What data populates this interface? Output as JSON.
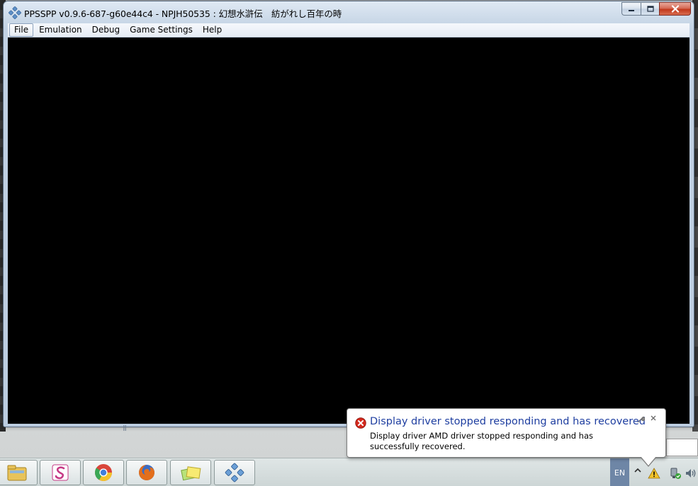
{
  "window": {
    "title": "PPSSPP v0.9.6-687-g60e44c4 - NPJH50535 : 幻想水滸伝　紡がれし百年の時"
  },
  "menu": {
    "items": [
      {
        "label": "File",
        "active": true
      },
      {
        "label": "Emulation",
        "active": false
      },
      {
        "label": "Debug",
        "active": false
      },
      {
        "label": "Game Settings",
        "active": false
      },
      {
        "label": "Help",
        "active": false
      }
    ]
  },
  "caption_buttons": {
    "minimize_icon": "minimize-icon",
    "maximize_icon": "maximize-icon",
    "close_icon": "close-icon"
  },
  "notification": {
    "title": "Display driver stopped responding and has recovered",
    "body": "Display driver AMD driver stopped responding and has successfully recovered.",
    "icon": "error-icon",
    "title_color": "#1e3ea0"
  },
  "taskbar": {
    "apps": [
      {
        "name": "windows-explorer",
        "icon": "folder-icon"
      },
      {
        "name": "paint-app",
        "icon": "paint-s-icon"
      },
      {
        "name": "chrome",
        "icon": "chrome-icon"
      },
      {
        "name": "firefox",
        "icon": "firefox-icon"
      },
      {
        "name": "sticky-notes",
        "icon": "notes-icon"
      },
      {
        "name": "ppsspp",
        "icon": "ppsspp-icon"
      }
    ],
    "language": "EN",
    "tray_icons": [
      "show-hidden-icons-arrow",
      "action-center-warning-icon",
      "network-icon",
      "volume-icon"
    ]
  },
  "colors": {
    "client_area": "#000000",
    "title_bar": "#c8d7e8",
    "close_button": "#c2381c",
    "language_indicator": "#6e86a6"
  }
}
